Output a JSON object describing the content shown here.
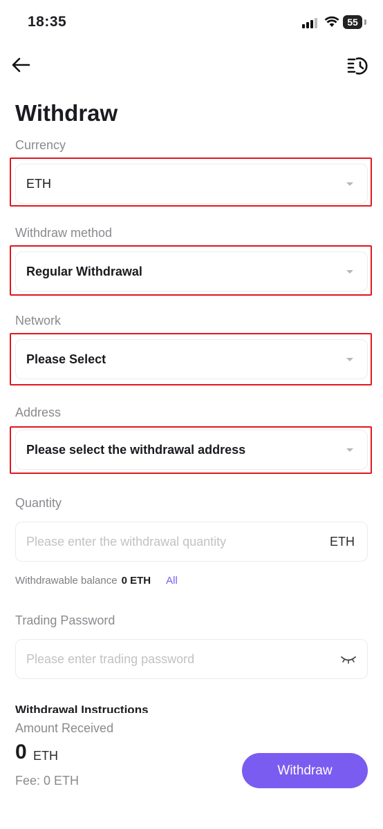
{
  "status_bar": {
    "time": "18:35",
    "battery": "55"
  },
  "page": {
    "title": "Withdraw"
  },
  "currency": {
    "label": "Currency",
    "value": "ETH"
  },
  "method": {
    "label": "Withdraw method",
    "value": "Regular Withdrawal"
  },
  "network": {
    "label": "Network",
    "value": "Please Select"
  },
  "address": {
    "label": "Address",
    "value": "Please select the withdrawal address"
  },
  "quantity": {
    "label": "Quantity",
    "placeholder": "Please enter the withdrawal quantity",
    "unit": "ETH",
    "balance_label": "Withdrawable balance",
    "balance_value": "0 ETH",
    "all_label": "All"
  },
  "password": {
    "label": "Trading Password",
    "placeholder": "Please enter trading password"
  },
  "instructions": {
    "title": "Withdrawal Instructions"
  },
  "summary": {
    "amount_label": "Amount Received",
    "amount_value": "0",
    "amount_unit": "ETH",
    "fee": "Fee: 0 ETH",
    "withdraw_label": "Withdraw"
  },
  "colors": {
    "accent": "#7b5cf0",
    "highlight": "#e0161e"
  }
}
